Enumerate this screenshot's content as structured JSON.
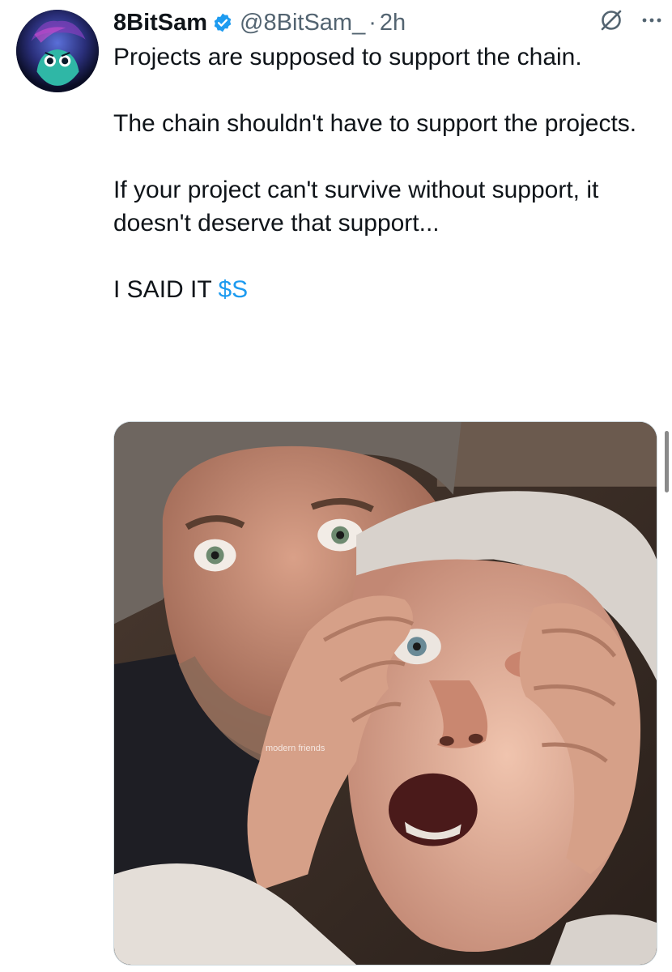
{
  "tweet": {
    "author_name": "8BitSam",
    "handle": "@8BitSam_",
    "separator": "·",
    "timestamp": "2h",
    "paragraphs": [
      "Projects are supposed to support the chain.",
      "The chain shouldn't have to support the projects.",
      "If your project can't survive without support, it doesn't deserve that support..."
    ],
    "last_line_text": "I SAID IT ",
    "cashtag": "$S",
    "media_watermark": "modern friends"
  },
  "icons": {
    "verified": "verified-badge-icon",
    "grok": "grok-icon",
    "more": "more-options-icon"
  },
  "colors": {
    "accent": "#1d9bf0",
    "text": "#0f1419",
    "secondary": "#536471"
  }
}
